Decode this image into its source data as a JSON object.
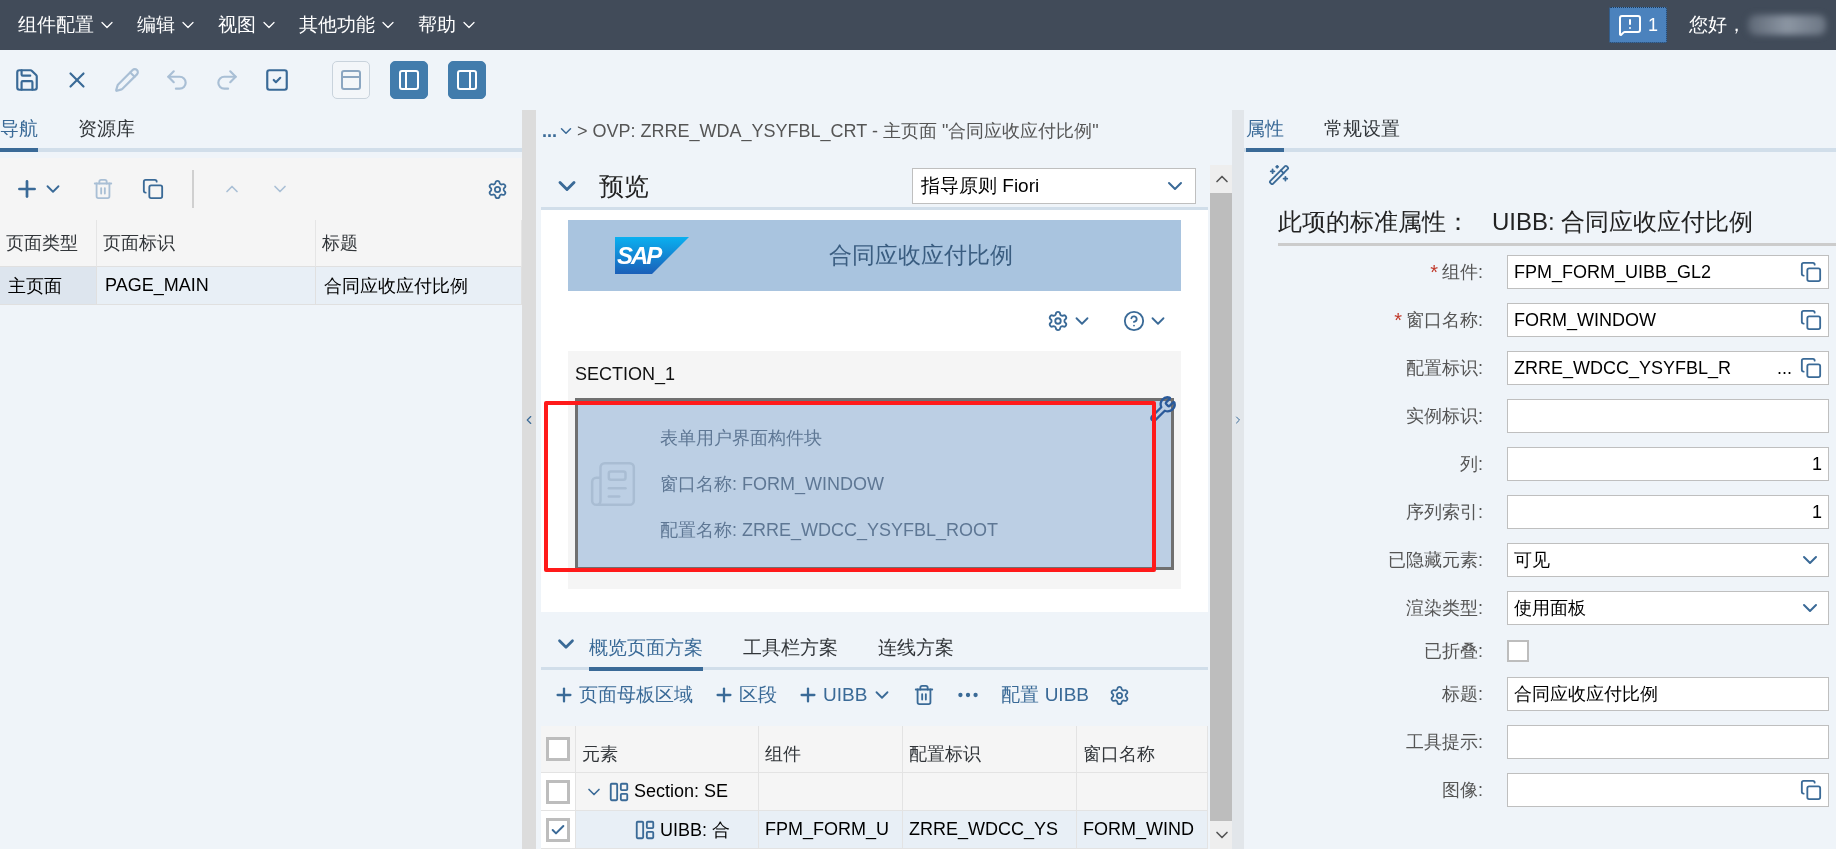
{
  "menu_bar": {
    "menus": [
      {
        "label": "组件配置"
      },
      {
        "label": "编辑"
      },
      {
        "label": "视图"
      },
      {
        "label": "其他功能"
      },
      {
        "label": "帮助"
      }
    ],
    "message_count": "1",
    "greeting": "您好，"
  },
  "toolbar": {
    "buttons": [
      {
        "kind": "save",
        "disabled": false
      },
      {
        "kind": "close",
        "disabled": false
      },
      {
        "kind": "edit",
        "disabled": true
      },
      {
        "kind": "undo",
        "disabled": true
      },
      {
        "kind": "redo",
        "disabled": true
      },
      {
        "kind": "check",
        "disabled": false
      }
    ],
    "layout_toggles": [
      {
        "kind": "header",
        "selected": false
      },
      {
        "kind": "left-panel",
        "selected": true
      },
      {
        "kind": "right-panel",
        "selected": true
      }
    ]
  },
  "navigation": {
    "tabs": [
      {
        "label": "导航",
        "selected": true
      },
      {
        "label": "资源库",
        "selected": false
      }
    ],
    "toolbar": [
      {
        "kind": "add-menu",
        "disabled": false
      },
      {
        "kind": "delete",
        "disabled": true
      },
      {
        "kind": "copy",
        "disabled": false
      },
      {
        "kind": "separator"
      },
      {
        "kind": "up",
        "disabled": true
      },
      {
        "kind": "down",
        "disabled": true
      },
      {
        "kind": "settings",
        "disabled": false
      }
    ],
    "table": {
      "columns": [
        "页面类型",
        "页面标识",
        "标题"
      ],
      "rows": [
        {
          "cells": [
            "主页面",
            "PAGE_MAIN",
            "合同应收应付比例"
          ],
          "selected": true
        }
      ]
    }
  },
  "breadcrumb": {
    "more": "...",
    "path": "> OVP: ZRRE_WDA_YSYFBL_CRT - 主页面 \"合同应收应付比例\""
  },
  "preview": {
    "title": "预览",
    "expanded": true,
    "guideline": "指导原则 Fiori",
    "logo": "SAP",
    "banner_title": "合同应收应付比例",
    "section": {
      "label": "SECTION_1",
      "uibb": {
        "highlighted": true,
        "lines": [
          "表单用户界面构件块",
          "窗口名称: FORM_WINDOW",
          "配置名称: ZRRE_WDCC_YSYFBL_ROOT"
        ]
      }
    }
  },
  "schema": {
    "expanded": true,
    "tabs": [
      {
        "label": "概览页面方案",
        "selected": true
      },
      {
        "label": "工具栏方案",
        "selected": false
      },
      {
        "label": "连线方案",
        "selected": false
      }
    ],
    "toolbar": [
      {
        "kind": "add",
        "label": "页面母板区域"
      },
      {
        "kind": "add",
        "label": "区段"
      },
      {
        "kind": "add-menu",
        "label": "UIBB"
      },
      {
        "kind": "delete"
      },
      {
        "kind": "more"
      },
      {
        "kind": "text",
        "label": "配置 UIBB"
      },
      {
        "kind": "settings"
      }
    ],
    "table": {
      "columns": [
        "元素",
        "组件",
        "配置标识",
        "窗口名称"
      ],
      "all_checked": false,
      "rows": [
        {
          "element": "Section: SE",
          "checked": false,
          "selected": false,
          "expanded": true,
          "children": [
            {
              "element": "UIBB: 合",
              "component": "FPM_FORM_U",
              "config_id": "ZRRE_WDCC_YS",
              "window": "FORM_WIND",
              "checked": true,
              "selected": true
            }
          ]
        }
      ]
    }
  },
  "properties": {
    "required_mark": "*",
    "tabs": [
      {
        "label": "属性",
        "selected": true
      },
      {
        "label": "常规设置",
        "selected": false
      }
    ],
    "heading_label": "此项的标准属性：",
    "heading_value": "UIBB: 合同应收应付比例",
    "fields": [
      {
        "label": "组件:",
        "required": true,
        "kind": "text",
        "value": "FPM_FORM_UIBB_GL2",
        "value_help": true
      },
      {
        "label": "窗口名称:",
        "required": true,
        "kind": "text",
        "value": "FORM_WINDOW",
        "value_help": true
      },
      {
        "label": "配置标识:",
        "required": false,
        "kind": "text",
        "value": "ZRRE_WDCC_YSYFBL_R",
        "more": "...",
        "value_help": true
      },
      {
        "label": "实例标识:",
        "required": false,
        "kind": "text",
        "value_help": false
      },
      {
        "label": "列:",
        "required": false,
        "kind": "number",
        "value": "1",
        "value_help": false
      },
      {
        "label": "序列索引:",
        "required": false,
        "kind": "number",
        "value": "1",
        "value_help": false
      },
      {
        "label": "已隐藏元素:",
        "required": false,
        "kind": "select",
        "value": "可见"
      },
      {
        "label": "渲染类型:",
        "required": false,
        "kind": "select",
        "value": "使用面板"
      },
      {
        "label": "已折叠:",
        "required": false,
        "kind": "checkbox",
        "checked": false
      },
      {
        "label": "标题:",
        "required": false,
        "kind": "text",
        "value": "合同应收应付比例",
        "value_help": false
      },
      {
        "label": "工具提示:",
        "required": false,
        "kind": "text",
        "value_help": false
      },
      {
        "label": "图像:",
        "required": false,
        "kind": "text",
        "value_help": true
      }
    ]
  }
}
